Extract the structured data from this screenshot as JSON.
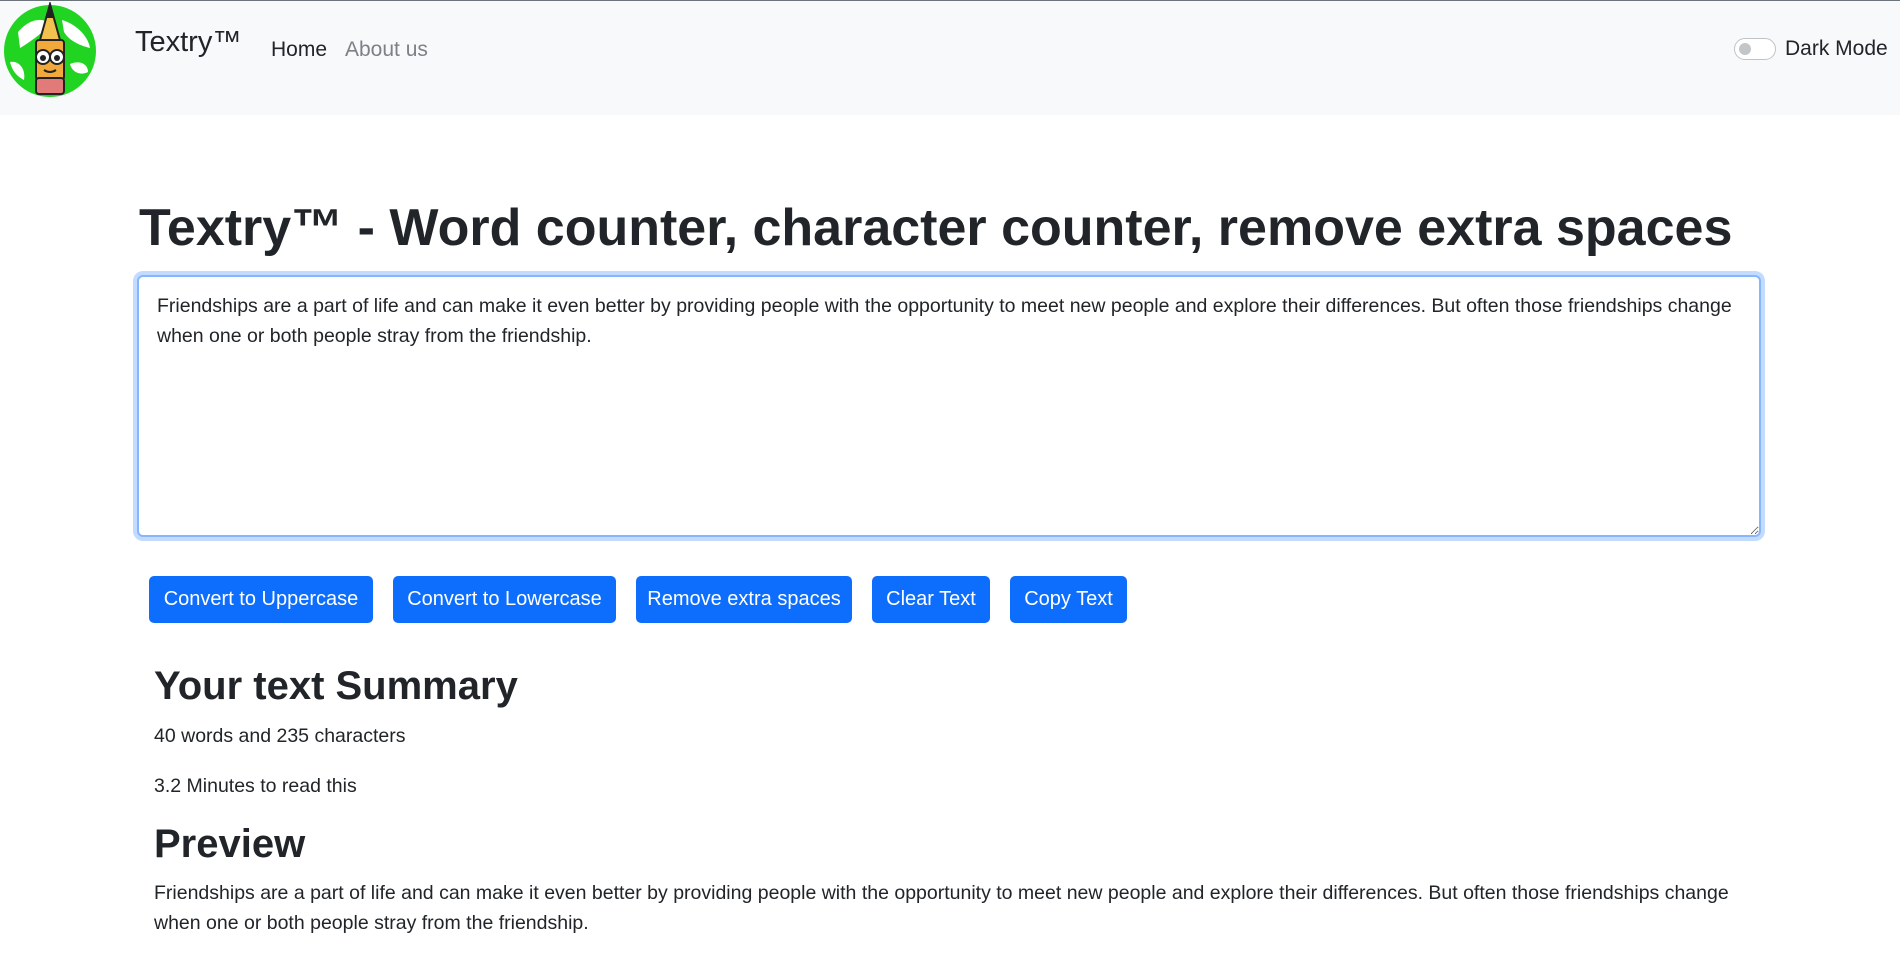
{
  "header": {
    "brand": "Textry™",
    "nav": {
      "home": "Home",
      "about": "About us"
    },
    "dark_mode_label": "Dark Mode",
    "dark_mode_enabled": false
  },
  "main": {
    "title": "Textry™ - Word counter, character counter, remove extra spaces",
    "textarea_value": "Friendships are a part of life and can make it even better by providing people with the opportunity to meet new people and explore their differences. But often those friendships change when one or both people stray from the friendship.",
    "buttons": {
      "uppercase": "Convert to Uppercase",
      "lowercase": "Convert to Lowercase",
      "remove_spaces": "Remove extra spaces",
      "clear": "Clear Text",
      "copy": "Copy Text"
    }
  },
  "summary": {
    "title": "Your text Summary",
    "counts": "40 words and 235 characters",
    "read_time": "3.2 Minutes to read this"
  },
  "preview": {
    "title": "Preview",
    "text": "Friendships are a part of life and can make it even better by providing people with the opportunity to meet new people and explore their differences. But often those friendships change when one or both people stray from the friendship."
  },
  "colors": {
    "primary": "#0d6efd",
    "navbar_bg": "#f8f9fa",
    "logo_green": "#22cc22"
  },
  "icons": {
    "logo": "pencil-globe-logo"
  }
}
